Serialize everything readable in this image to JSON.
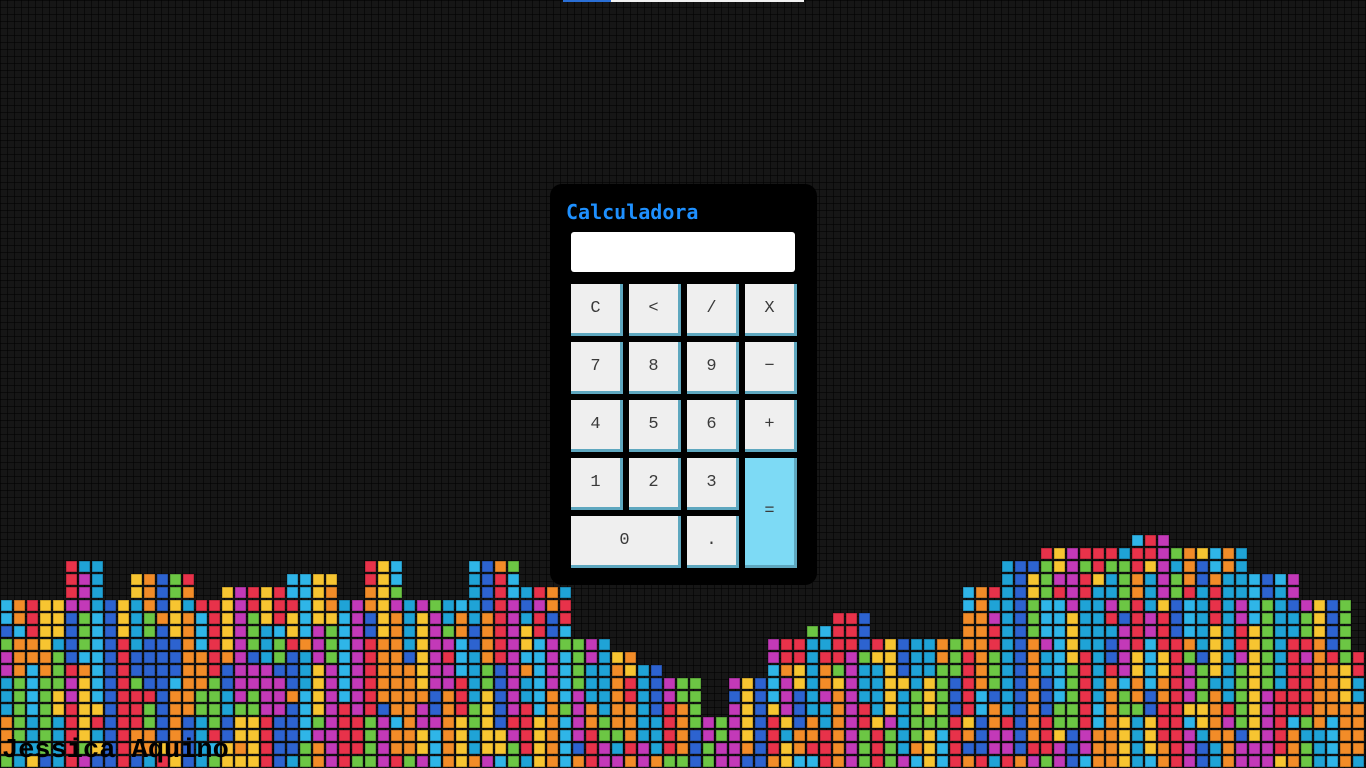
{
  "page": {
    "background_color": "#161616",
    "block_colors": [
      "#e8324a",
      "#f28c28",
      "#f7c531",
      "#6cc644",
      "#2fb5e8",
      "#2d63d0",
      "#c339b8",
      "#1fa3d6"
    ]
  },
  "calculator": {
    "title": "Calculadora",
    "title_color": "#1e90ff",
    "display_value": "",
    "equals_color": "#7ddaf5",
    "keys": [
      {
        "label": "C",
        "name": "clear-button"
      },
      {
        "label": "<",
        "name": "backspace-button"
      },
      {
        "label": "/",
        "name": "divide-button"
      },
      {
        "label": "X",
        "name": "multiply-button"
      },
      {
        "label": "7",
        "name": "digit-7-button"
      },
      {
        "label": "8",
        "name": "digit-8-button"
      },
      {
        "label": "9",
        "name": "digit-9-button"
      },
      {
        "label": "−",
        "name": "subtract-button"
      },
      {
        "label": "4",
        "name": "digit-4-button"
      },
      {
        "label": "5",
        "name": "digit-5-button"
      },
      {
        "label": "6",
        "name": "digit-6-button"
      },
      {
        "label": "+",
        "name": "add-button"
      },
      {
        "label": "1",
        "name": "digit-1-button"
      },
      {
        "label": "2",
        "name": "digit-2-button"
      },
      {
        "label": "3",
        "name": "digit-3-button"
      },
      {
        "label": "=",
        "name": "equals-button"
      },
      {
        "label": "0",
        "name": "digit-0-button"
      },
      {
        "label": ".",
        "name": "decimal-button"
      }
    ]
  },
  "footer": {
    "author": "Jessica Aquino"
  }
}
